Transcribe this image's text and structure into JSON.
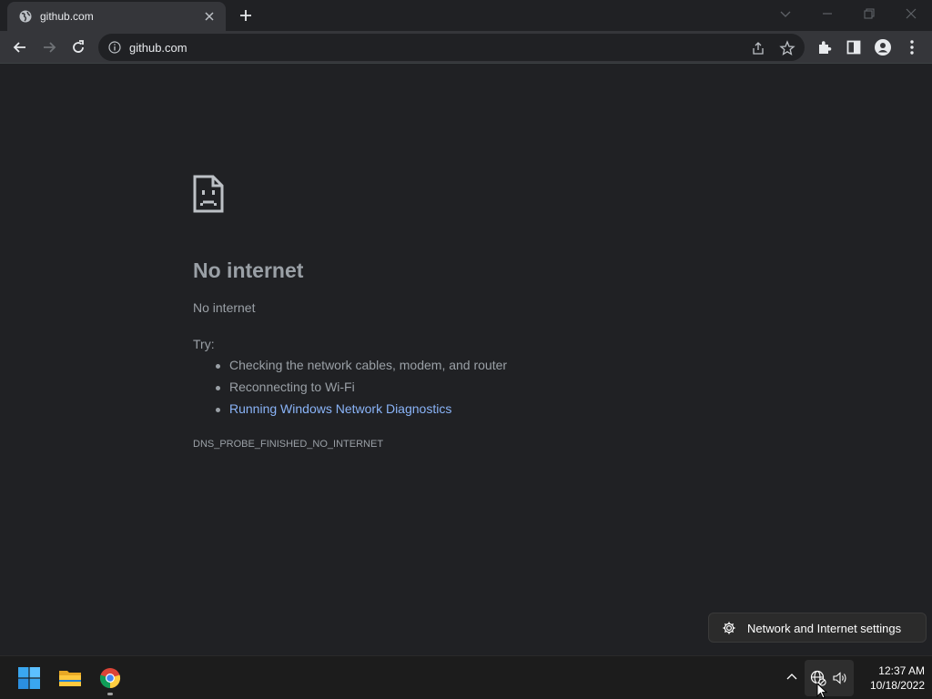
{
  "browser": {
    "tab": {
      "title": "github.com"
    },
    "address_bar": {
      "url": "github.com"
    }
  },
  "page": {
    "heading": "No internet",
    "subtitle": "No internet",
    "try_label": "Try:",
    "suggestions": [
      "Checking the network cables, modem, and router",
      "Reconnecting to Wi-Fi",
      "Running Windows Network Diagnostics"
    ],
    "error_code": "DNS_PROBE_FINISHED_NO_INTERNET"
  },
  "flyout": {
    "label": "Network and Internet settings"
  },
  "taskbar": {
    "time": "12:37 AM",
    "date": "10/18/2022"
  },
  "colors": {
    "background": "#202124",
    "toolbar": "#35363a",
    "link": "#8ab4f8",
    "text_muted": "#9aa0a6"
  }
}
